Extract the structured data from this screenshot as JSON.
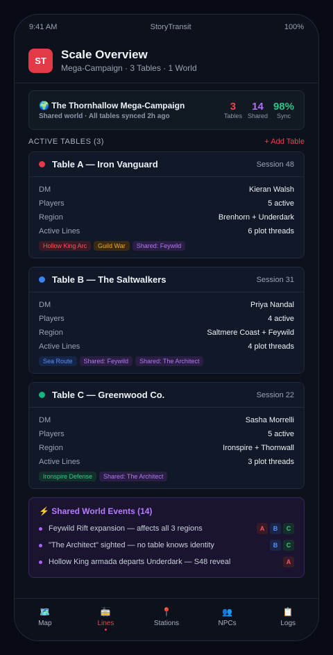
{
  "status_bar": {
    "time": "9:41 AM",
    "app": "StoryTransit",
    "battery": "100%"
  },
  "header": {
    "logo": "ST",
    "title": "Scale Overview",
    "subtitle": "Mega-Campaign · 3 Tables · 1 World",
    "logo_color": "#e23a46"
  },
  "banner": {
    "icon": "🌍",
    "title": "The Thornhallow Mega-Campaign",
    "subtitle": "Shared world · All tables synced 2h ago",
    "stats": [
      {
        "value": "3",
        "label": "Tables",
        "color": "#ef4450"
      },
      {
        "value": "14",
        "label": "Shared",
        "color": "#b06cf5"
      },
      {
        "value": "98%",
        "label": "Sync",
        "color": "#2fc28a"
      }
    ]
  },
  "section": {
    "title": "ACTIVE TABLES (3)",
    "add_label": "+ Add Table"
  },
  "field_labels": {
    "dm": "DM",
    "players": "Players",
    "region": "Region",
    "lines": "Active Lines"
  },
  "tables": [
    {
      "name": "Table A — Iron Vanguard",
      "session": "Session 48",
      "color": "#e23a46",
      "dm": "Kieran Walsh",
      "players": "5 active",
      "region": "Brenhorn + Underdark",
      "lines": "6 plot threads",
      "tags": [
        {
          "label": "Hollow King Arc",
          "kind": "red"
        },
        {
          "label": "Guild War",
          "kind": "orange"
        },
        {
          "label": "Shared: Feywild",
          "kind": "purple"
        }
      ]
    },
    {
      "name": "Table B — The Saltwalkers",
      "session": "Session 31",
      "color": "#3b82f6",
      "dm": "Priya Nandal",
      "players": "4 active",
      "region": "Saltmere Coast + Feywild",
      "lines": "4 plot threads",
      "tags": [
        {
          "label": "Sea Route",
          "kind": "blue"
        },
        {
          "label": "Shared: Feywild",
          "kind": "purple"
        },
        {
          "label": "Shared: The Architect",
          "kind": "purple"
        }
      ]
    },
    {
      "name": "Table C — Greenwood Co.",
      "session": "Session 22",
      "color": "#14b87e",
      "dm": "Sasha Morrelli",
      "players": "5 active",
      "region": "Ironspire + Thornwall",
      "lines": "3 plot threads",
      "tags": [
        {
          "label": "Ironspire Defense",
          "kind": "green"
        },
        {
          "label": "Shared: The Architect",
          "kind": "purple"
        }
      ]
    }
  ],
  "events": {
    "title": "⚡ Shared World Events (14)",
    "items": [
      {
        "text": "Feywild Rift expansion — affects all 3 regions",
        "badges": [
          "A",
          "B",
          "C"
        ]
      },
      {
        "text": "\"The Architect\" sighted — no table knows identity",
        "badges": [
          "B",
          "C"
        ]
      },
      {
        "text": "Hollow King armada departs Underdark — S48 reveal",
        "badges": [
          "A"
        ]
      }
    ]
  },
  "nav": [
    {
      "icon": "🗺️",
      "label": "Map",
      "icon_name": "map-icon"
    },
    {
      "icon": "🚋",
      "label": "Lines",
      "icon_name": "tram-icon",
      "active": true
    },
    {
      "icon": "📍",
      "label": "Stations",
      "icon_name": "pin-icon"
    },
    {
      "icon": "👥",
      "label": "NPCs",
      "icon_name": "people-icon"
    },
    {
      "icon": "📋",
      "label": "Logs",
      "icon_name": "clipboard-icon"
    }
  ]
}
